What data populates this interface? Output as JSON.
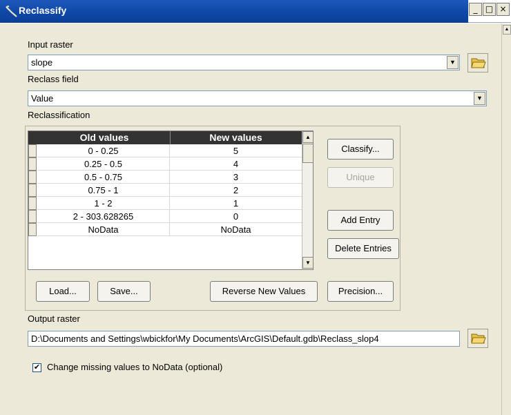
{
  "window": {
    "title": "Reclassify",
    "controls": [
      "_",
      "□",
      "×"
    ]
  },
  "input_raster": {
    "label": "Input raster",
    "value": "slope"
  },
  "reclass_field": {
    "label": "Reclass field",
    "value": "Value"
  },
  "reclassification": {
    "label": "Reclassification",
    "columns": [
      "Old values",
      "New values"
    ],
    "rows": [
      {
        "old": "0 - 0.25",
        "new": "5"
      },
      {
        "old": "0.25 - 0.5",
        "new": "4"
      },
      {
        "old": "0.5 - 0.75",
        "new": "3"
      },
      {
        "old": "0.75 - 1",
        "new": "2"
      },
      {
        "old": "1 - 2",
        "new": "1"
      },
      {
        "old": "2 - 303.628265",
        "new": "0"
      },
      {
        "old": "NoData",
        "new": "NoData"
      }
    ],
    "buttons": {
      "classify": "Classify...",
      "unique": "Unique",
      "add_entry": "Add Entry",
      "delete_entries": "Delete Entries",
      "load": "Load...",
      "save": "Save...",
      "reverse": "Reverse New Values",
      "precision": "Precision..."
    }
  },
  "output_raster": {
    "label": "Output raster",
    "value": "D:\\Documents and Settings\\wbickfor\\My Documents\\ArcGIS\\Default.gdb\\Reclass_slop4"
  },
  "missing_values": {
    "label": "Change missing values to NoData (optional)",
    "checked": true
  },
  "colors": {
    "title_bar": "#0f47a6",
    "panel": "#ece9d8",
    "grid_header": "#333333"
  }
}
